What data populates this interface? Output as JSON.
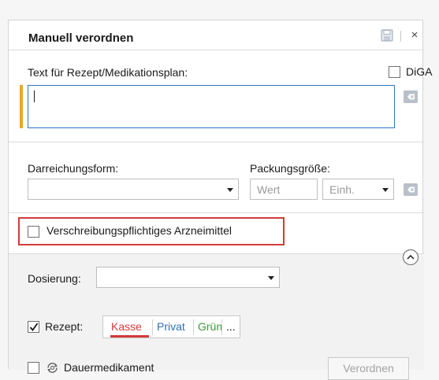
{
  "dialog": {
    "title": "Manuell verordnen",
    "close_label": "×"
  },
  "rx_text": {
    "label": "Text für Rezept/Medikationsplan:",
    "value": "",
    "diga_label": "DiGA",
    "diga_checked": false
  },
  "dosage_form": {
    "label": "Darreichungsform:",
    "value": ""
  },
  "package_size": {
    "label": "Packungsgröße:",
    "value_placeholder": "Wert",
    "unit_placeholder": "Einh."
  },
  "prescription_only": {
    "label": "Verschreibungspflichtiges Arzneimittel",
    "checked": false
  },
  "dosage": {
    "label": "Dosierung:",
    "value": ""
  },
  "prescription": {
    "label": "Rezept:",
    "checked": true,
    "types": [
      {
        "label": "Kasse",
        "color": "#d33a3a",
        "selected": true
      },
      {
        "label": "Privat",
        "color": "#2f6fb3",
        "selected": false
      },
      {
        "label": "Grün",
        "color": "#3a9a3a",
        "selected": false
      }
    ],
    "more_label": "..."
  },
  "permanent_medication": {
    "label": "Dauermedikament",
    "checked": false
  },
  "actions": {
    "submit_label": "Verordnen"
  },
  "colors": {
    "accent_blue": "#2b78c5",
    "warning_red": "#d33a3a",
    "marker_orange": "#e9a825"
  }
}
